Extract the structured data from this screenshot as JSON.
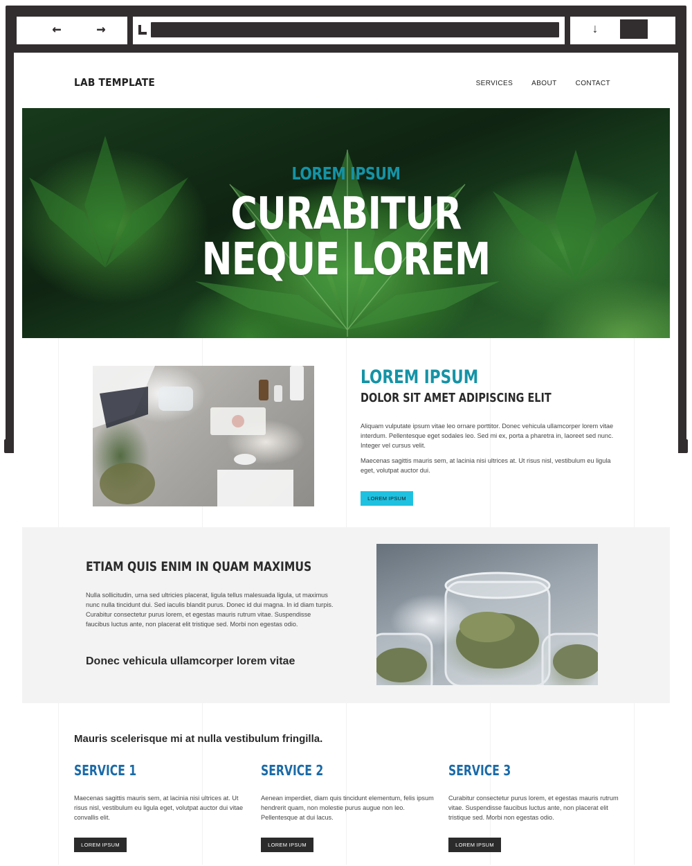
{
  "browser": {
    "back_icon": "arrow-left-icon",
    "forward_icon": "arrow-right-icon",
    "frame_color": "#322d2f"
  },
  "header": {
    "logo": "LAB TEMPLATE",
    "nav": [
      "SERVICES",
      "ABOUT",
      "CONTACT"
    ]
  },
  "hero": {
    "eyebrow": "LOREM IPSUM",
    "title_line1": "CURABITUR",
    "title_line2": "NEQUE LOREM"
  },
  "section1": {
    "heading": "LOREM IPSUM",
    "subheading": "DOLOR SIT AMET ADIPISCING ELIT",
    "para1": "Aliquam vulputate ipsum vitae leo ornare porttitor. Donec vehicula ullamcorper lorem vitae interdum. Pellentesque eget sodales leo. Sed mi ex, porta a pharetra in, laoreet sed nunc. Integer vel cursus velit.",
    "para2": "Maecenas sagittis mauris sem, at lacinia nisi ultrices at. Ut risus nisl, vestibulum eu ligula eget, volutpat auctor dui.",
    "button": "LOREM IPSUM"
  },
  "section2": {
    "heading": "ETIAM QUIS ENIM IN QUAM MAXIMUS",
    "para": "Nulla sollicitudin, urna sed ultricies placerat, ligula tellus malesuada ligula, ut maximus nunc nulla tincidunt dui. Sed iaculis blandit purus. Donec id dui magna. In id diam turpis. Curabitur consectetur purus lorem, et egestas mauris rutrum vitae. Suspendisse faucibus luctus ante, non placerat elit tristique sed. Morbi non egestas odio.",
    "tagline": "Donec vehicula ullamcorper lorem vitae"
  },
  "services": {
    "title": "Mauris scelerisque mi at nulla vestibulum fringilla.",
    "items": [
      {
        "title": "SERVICE 1",
        "text": "Maecenas sagittis mauris sem, at lacinia nisi ultrices at. Ut risus nisl, vestibulum eu ligula eget, volutpat auctor dui vitae convallis elit.",
        "button": "LOREM IPSUM"
      },
      {
        "title": "SERVICE 2",
        "text": "Aenean imperdiet, diam quis tincidunt elementum, felis ipsum hendrerit quam, non molestie purus augue non leo. Pellentesque at dui lacus.",
        "button": "LOREM IPSUM"
      },
      {
        "title": "SERVICE 3",
        "text": "Curabitur consectetur purus lorem, et egestas mauris rutrum vitae. Suspendisse faucibus luctus ante, non placerat elit tristique sed. Morbi non egestas odio.",
        "button": "LOREM IPSUM"
      }
    ]
  },
  "colors": {
    "accent_teal": "#1593a6",
    "button_cyan": "#1fc1e0",
    "service_blue": "#1a6aa8",
    "button_dark": "#2b2b2b",
    "band_gray": "#f3f3f3"
  }
}
